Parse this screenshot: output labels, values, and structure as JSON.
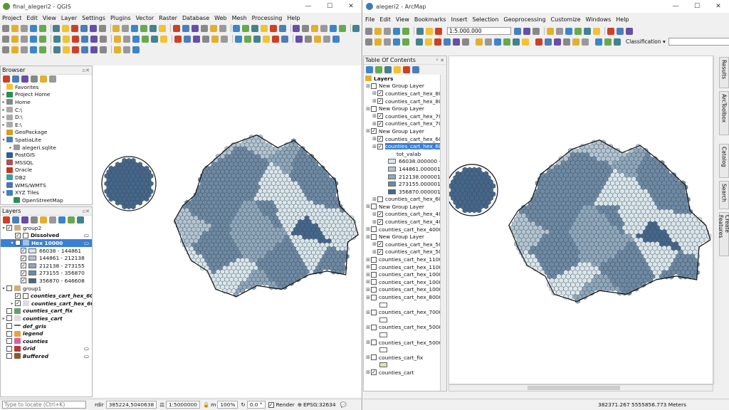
{
  "qgis": {
    "title": "final_alegeri2 - QGIS",
    "menu": [
      "Project",
      "Edit",
      "View",
      "Layer",
      "Settings",
      "Plugins",
      "Vector",
      "Raster",
      "Database",
      "Web",
      "Mesh",
      "Processing",
      "Help"
    ],
    "browser": {
      "title": "Browser",
      "items": [
        "Favorites",
        "Project Home",
        "Home",
        "C:\\",
        "D:\\",
        "E:\\",
        "GeoPackage",
        "SpatiaLite",
        "alegeri.sqlite",
        "PostGIS",
        "MSSQL",
        "Oracle",
        "DB2",
        "WMS/WMTS",
        "XYZ Tiles",
        "OpenStreetMap"
      ]
    },
    "layers": {
      "title": "Layers",
      "group2": "group2",
      "dissolved": "Dissolved",
      "hex": "Hex 10000",
      "legend": [
        "66038 - 144861",
        "144861 - 212138",
        "212138 - 273155",
        "273155 - 356870",
        "356870 - 646608"
      ],
      "group1": "group1",
      "g1a": "counties_cart_hex_60...",
      "g1b": "counties_cart_hex_60...",
      "others": [
        "counties_cart_fix",
        "counties_cart",
        "def_gris",
        "legend",
        "counties",
        "Grid",
        "Buffered"
      ]
    },
    "status": {
      "locate": "Type to locate (Ctrl+K)",
      "coord_label": "rdir",
      "coord": "385224,5040638",
      "scale": "1:5000000",
      "mag_label": "m",
      "mag": "100%",
      "rot_label": "",
      "rotation": "0.0 °",
      "render": "Render",
      "crs": "EPSG:32634"
    }
  },
  "arcmap": {
    "title": "alegeri2 - ArcMap",
    "menu": [
      "File",
      "Edit",
      "View",
      "Bookmarks",
      "Insert",
      "Selection",
      "Geoprocessing",
      "Customize",
      "Windows",
      "Help"
    ],
    "scale": "1:5.000.000",
    "classification": "Classification ▾",
    "toc": {
      "title": "Table Of Contents",
      "layers_label": "Layers",
      "rows": [
        {
          "t": "g",
          "label": "New Group Layer",
          "lvl": 1,
          "chk": false
        },
        {
          "t": "l",
          "label": "counties_cart_hex_80",
          "lvl": 2,
          "chk": true
        },
        {
          "t": "l",
          "label": "counties_cart_hex_80",
          "lvl": 2,
          "chk": true
        },
        {
          "t": "g",
          "label": "New Group Layer",
          "lvl": 1,
          "chk": false
        },
        {
          "t": "l",
          "label": "counties_cart_hex_70",
          "lvl": 2,
          "chk": true
        },
        {
          "t": "l",
          "label": "counties_cart_hex_70",
          "lvl": 2,
          "chk": true
        },
        {
          "t": "g",
          "label": "New Group Layer",
          "lvl": 1,
          "chk": true
        },
        {
          "t": "l",
          "label": "counties_cart_hex_60",
          "lvl": 2,
          "chk": true
        },
        {
          "t": "s",
          "label": "counties_cart_hex_60",
          "lvl": 2,
          "chk": true
        }
      ],
      "field": "tot_valab",
      "classes": [
        "66038.000000 - 144",
        "144861.000001 - 21",
        "212138.000001 - 27",
        "273155.000001 - 35",
        "356870.000001 - 64"
      ],
      "rows2": [
        {
          "t": "l",
          "label": "counties_cart_hex_60",
          "lvl": 2,
          "chk": false
        },
        {
          "t": "g",
          "label": "New Group Layer",
          "lvl": 1,
          "chk": false
        },
        {
          "t": "l",
          "label": "counties_cart_hex_40",
          "lvl": 2,
          "chk": true
        },
        {
          "t": "l",
          "label": "counties_cart_hex_40",
          "lvl": 2,
          "chk": true
        },
        {
          "t": "l",
          "label": "counties_cart_hex_4000",
          "lvl": 1,
          "chk": false
        },
        {
          "t": "g",
          "label": "New Group Layer",
          "lvl": 1,
          "chk": false
        },
        {
          "t": "l",
          "label": "counties_cart_hex_50",
          "lvl": 2,
          "chk": true
        },
        {
          "t": "l",
          "label": "counties_cart_hex_50",
          "lvl": 2,
          "chk": true
        },
        {
          "t": "l",
          "label": "counties_cart_hex_11000",
          "lvl": 1,
          "chk": false
        },
        {
          "t": "l",
          "label": "counties_cart_hex_11000",
          "lvl": 1,
          "chk": false
        },
        {
          "t": "l",
          "label": "counties_cart_hex_10000",
          "lvl": 1,
          "chk": false
        },
        {
          "t": "l",
          "label": "counties_cart_hex_10000",
          "lvl": 1,
          "chk": false
        },
        {
          "t": "l",
          "label": "counties_cart_hex_10000",
          "lvl": 1,
          "chk": false
        },
        {
          "t": "l",
          "label": "counties_cart_hex_8000",
          "lvl": 1,
          "chk": false
        },
        {
          "t": "b",
          "label": "",
          "lvl": 2,
          "chk": false
        },
        {
          "t": "l",
          "label": "counties_cart_hex_7000",
          "lvl": 1,
          "chk": false
        },
        {
          "t": "b",
          "label": "",
          "lvl": 2,
          "chk": false
        },
        {
          "t": "l",
          "label": "counties_cart_hex_5000",
          "lvl": 1,
          "chk": false
        },
        {
          "t": "b",
          "label": "",
          "lvl": 2,
          "chk": false
        },
        {
          "t": "l",
          "label": "counties_cart_hex_50000",
          "lvl": 1,
          "chk": false
        },
        {
          "t": "b",
          "label": "",
          "lvl": 2,
          "chk": false
        },
        {
          "t": "l",
          "label": "counties_cart_fix",
          "lvl": 1,
          "chk": false
        },
        {
          "t": "bg",
          "label": "",
          "lvl": 2,
          "chk": false
        },
        {
          "t": "l",
          "label": "counties_cart",
          "lvl": 1,
          "chk": true
        }
      ]
    },
    "side_tabs": [
      "Results",
      "ArcToolbox",
      "Catalog",
      "Search",
      "Create Features"
    ],
    "status": {
      "coords": "382371.267  5555856.773 Meters"
    }
  },
  "colors": {
    "c1": "#dbe6ea",
    "c2": "#b4c5d1",
    "c3": "#91a8bb",
    "c4": "#6f8aa3",
    "c5": "#46678a",
    "selection": "#3a7fd4"
  }
}
